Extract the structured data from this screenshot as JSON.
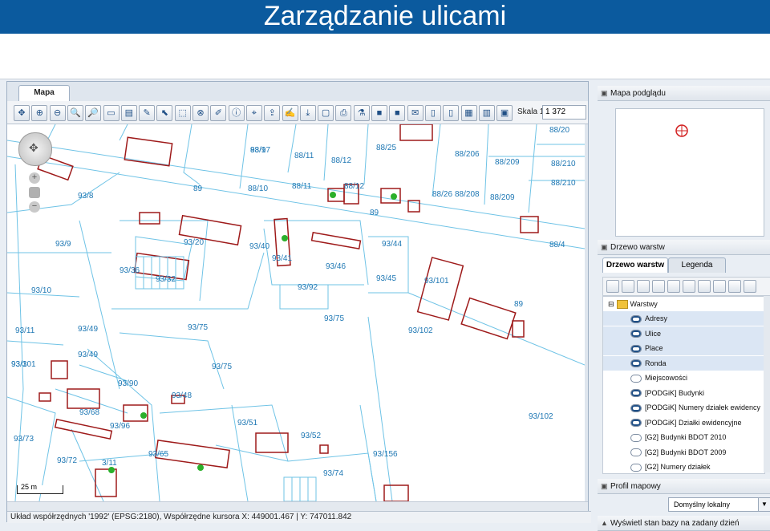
{
  "slide_title": "Zarządzanie ulicami",
  "map_tab": "Mapa",
  "toolbar": {
    "scale_label": "Skala 1 :",
    "scale_value": "1 372",
    "buttons": [
      "pan-icon",
      "zoom-in-box-icon",
      "zoom-out-box-icon",
      "zoom-in-icon",
      "zoom-out-icon",
      "measure-icon",
      "layers-icon",
      "pencil-icon",
      "select-icon",
      "select-area-icon",
      "target-icon",
      "brush-icon",
      "info-icon",
      "coordinates-icon",
      "export-icon",
      "edit-icon",
      "download-icon",
      "blank-icon",
      "print-icon",
      "flask-icon",
      "camera-icon",
      "camera2-icon",
      "note-icon",
      "doc-icon",
      "doc2-icon",
      "report-icon",
      "chart-icon",
      "monitor-icon"
    ]
  },
  "map": {
    "scalebar": "25 m",
    "parcels": [
      "88/9",
      "88/11",
      "88/12",
      "88/25",
      "88/206",
      "88/209",
      "88/210",
      "88/20",
      "88/10",
      "88/11",
      "88/12",
      "93/8",
      "89",
      "93/9",
      "93/20",
      "93/40",
      "93/41",
      "93/46",
      "93/44",
      "93/45",
      "93/101",
      "93/10",
      "93/36",
      "93/32",
      "93/92",
      "93/11",
      "93/49",
      "93/75",
      "93/102",
      "93/3",
      "93/49",
      "93/75",
      "93/75",
      "93/90",
      "93/48",
      "93/68",
      "93/51",
      "93/52",
      "93/96",
      "93/73",
      "93/72",
      "93/65",
      "93/156",
      "93/74",
      "93/102",
      "88/26",
      "88/208",
      "88/209",
      "88/210",
      "89",
      "88/4",
      "89",
      "93/101",
      "3/11",
      "93/17"
    ]
  },
  "status": "Układ współrzędnych '1992' (EPSG:2180), Współrzędne kursora X: 449001.467 | Y: 747011.842",
  "right": {
    "preview_title": "Mapa podglądu",
    "tree_title": "Drzewo warstw",
    "tabs": [
      "Drzewo warstw",
      "Legenda"
    ],
    "root": "Warstwy",
    "layers": [
      "Adresy",
      "Ulice",
      "Place",
      "Ronda",
      "Miejscowości",
      "[PODGiK] Budynki",
      "[PODGiK] Numery działek ewidency",
      "[PODGiK] Działki ewidencyjne",
      "[G2] Budynki BDOT 2010",
      "[G2] Budynki BDOT 2009",
      "[G2] Numery działek"
    ],
    "profile_title": "Profil mapowy",
    "profile_value": "Domyślny lokalny",
    "bottom_title": "Wyświetl stan bazy na zadany dzień"
  },
  "colors": {
    "accent": "#0b5a9e",
    "parcel_line": "#6fc3e6",
    "building": "#9e1a1a",
    "marker": "#2bb02b"
  }
}
